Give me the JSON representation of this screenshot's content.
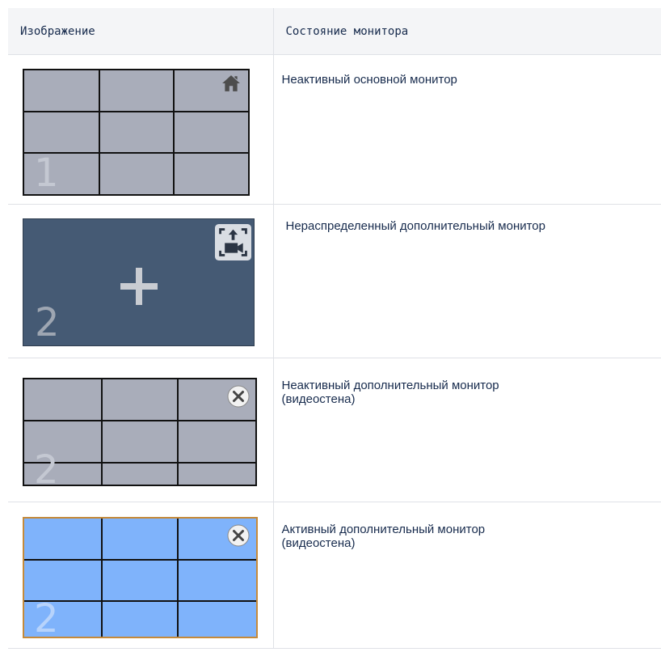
{
  "table": {
    "header": {
      "image": "Изображение",
      "state": "Состояние монитора"
    },
    "rows": [
      {
        "monitor_number": "1",
        "description": "Неактивный основной монитор",
        "corner_icon": "home-icon",
        "fill": "#a9adba"
      },
      {
        "monitor_number": "2",
        "description": "Нераспределенный дополнительный монитор",
        "corner_icon": "assign-camera-icon",
        "center_icon": "plus-icon",
        "fill": "#455a74"
      },
      {
        "monitor_number": "2",
        "description": "Неактивный дополнительный монитор\n(видеостена)",
        "corner_icon": "close-icon",
        "fill": "#a9adba"
      },
      {
        "monitor_number": "2",
        "description": "Активный дополнительный монитор\n(видеостена)",
        "corner_icon": "close-icon",
        "fill": "#7fb3fb",
        "border_color": "#c58a3a"
      }
    ]
  }
}
